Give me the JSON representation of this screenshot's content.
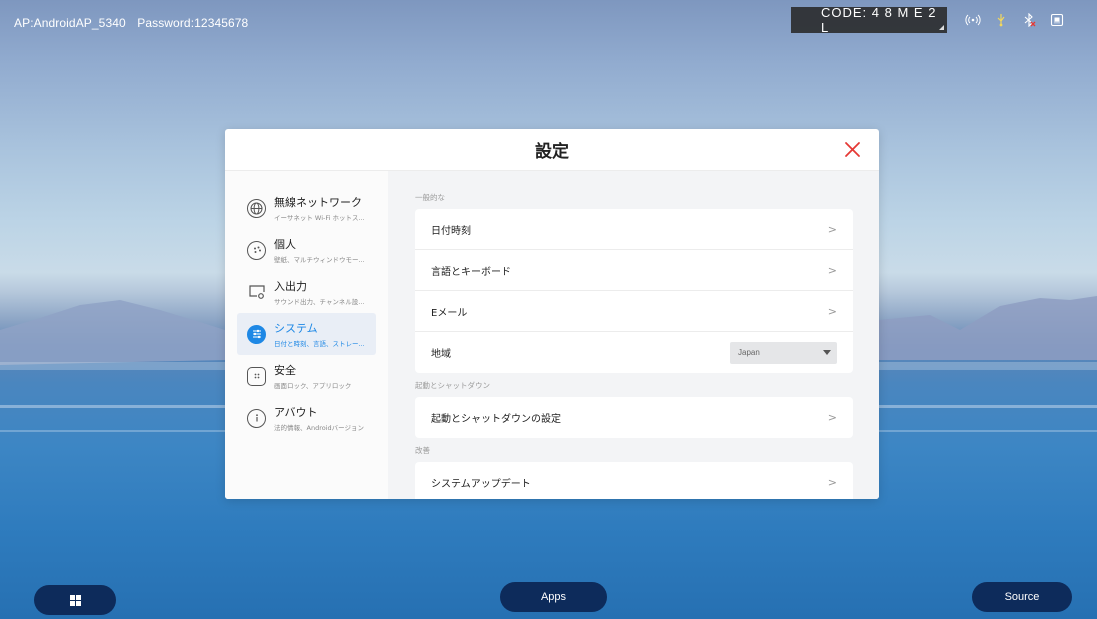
{
  "status_bar": {
    "ap": "AP:AndroidAP_5340",
    "password": "Password:12345678",
    "code": "CODE: 4 8 M E 2 L",
    "icons": [
      "hotspot-icon",
      "usb-icon",
      "bluetooth-icon",
      "network-icon"
    ]
  },
  "dialog": {
    "title": "設定",
    "sidebar": [
      {
        "name": "無線ネットワーク",
        "sub": "イーサネット Wi-Fi ホットス...",
        "icon": "globe-icon"
      },
      {
        "name": "個人",
        "sub": "壁紙、マルチウィンドウモー...",
        "icon": "palette-icon"
      },
      {
        "name": "入出力",
        "sub": "サウンド出力、チャンネル設...",
        "icon": "display-io-icon"
      },
      {
        "name": "システム",
        "sub": "日付と時刻、言語、ストレー...",
        "icon": "sliders-icon"
      },
      {
        "name": "安全",
        "sub": "画面ロック、アプリロック",
        "icon": "lock-icon"
      },
      {
        "name": "アバウト",
        "sub": "法的情報、Androidバージョン",
        "icon": "info-icon"
      }
    ],
    "sections": {
      "general_label": "一般的な",
      "general_rows": [
        "日付時刻",
        "言語とキーボード",
        "Eメール"
      ],
      "region_label": "地域",
      "region_value": "Japan",
      "boot_label": "起動とシャットダウン",
      "boot_row": "起動とシャットダウンの設定",
      "update_label": "改善",
      "update_row": "システムアップデート"
    }
  },
  "bottom_bar": {
    "apps": "Apps",
    "source": "Source"
  },
  "colors": {
    "accent": "#1e88e5",
    "pill": "#0d2b5b"
  }
}
